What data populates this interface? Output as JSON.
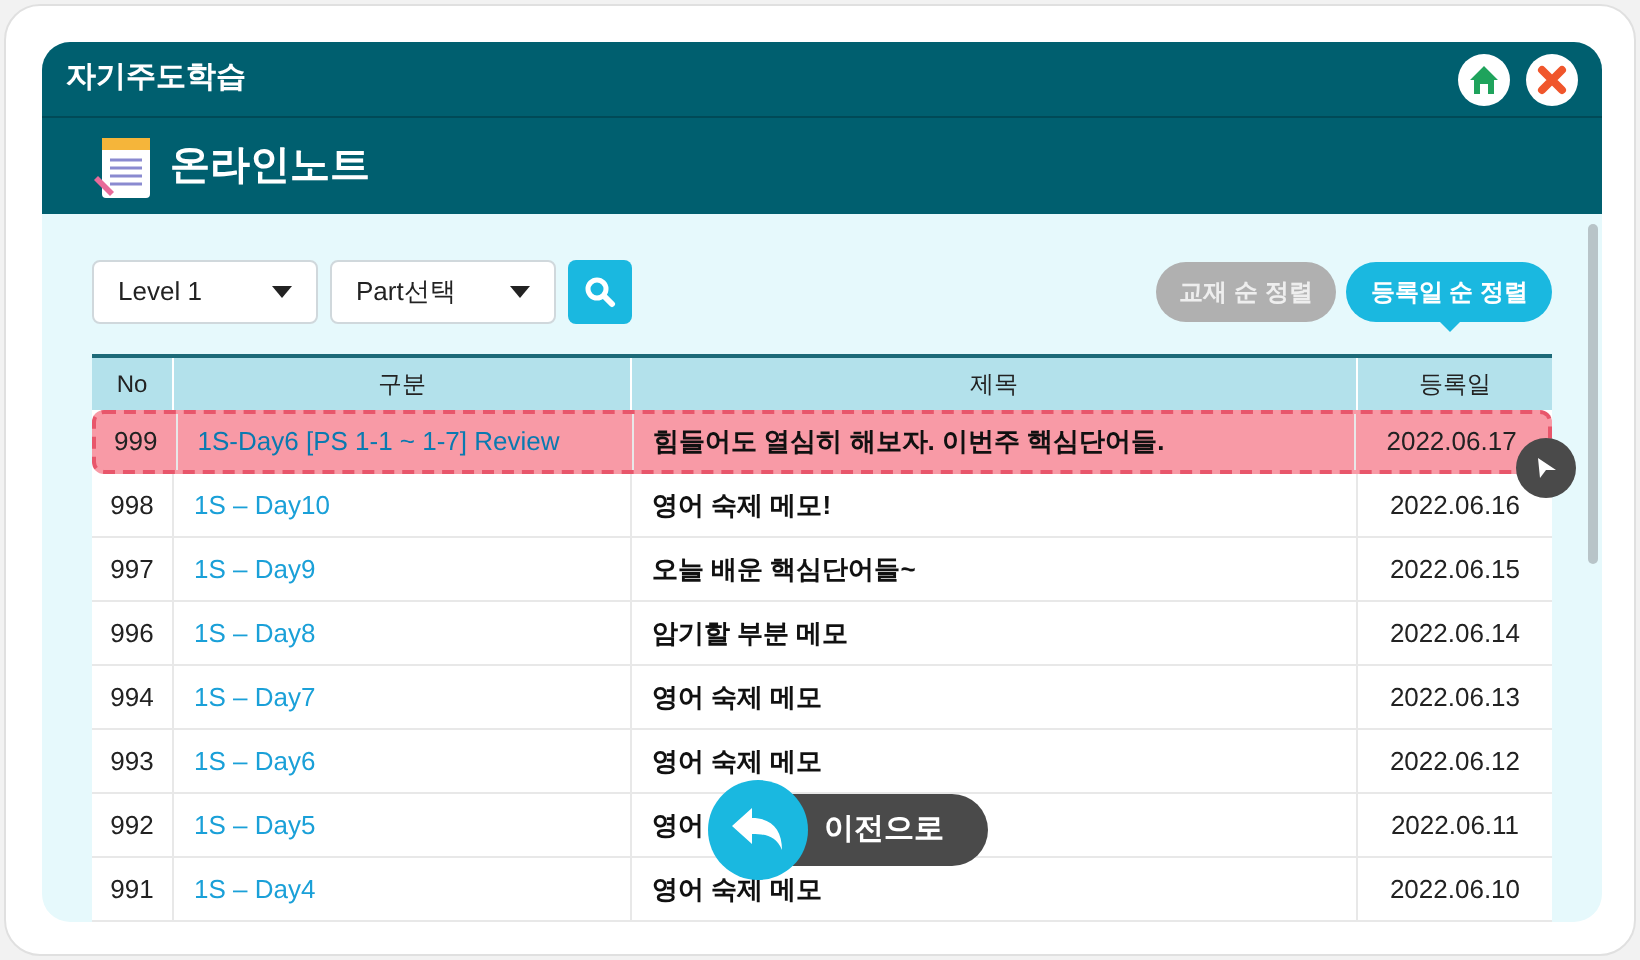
{
  "window": {
    "title": "자기주도학습"
  },
  "header": {
    "title": "온라인노트"
  },
  "filters": [
    {
      "value": "Level 1"
    },
    {
      "value": "Part선택"
    }
  ],
  "sort_buttons": [
    {
      "label": "교재 순 정렬",
      "selected": false
    },
    {
      "label": "등록일 순 정렬",
      "selected": true
    }
  ],
  "table": {
    "columns": [
      "No",
      "구분",
      "제목",
      "등록일"
    ],
    "rows": [
      {
        "no": "999",
        "category": "1S-Day6 [PS 1-1 ~ 1-7] Review",
        "title": "힘들어도 열심히 해보자. 이번주 핵심단어들.",
        "date": "2022.06.17",
        "selected": true
      },
      {
        "no": "998",
        "category": "1S – Day10",
        "title": "영어 숙제 메모!",
        "date": "2022.06.16",
        "selected": false
      },
      {
        "no": "997",
        "category": "1S – Day9",
        "title": "오늘 배운 핵심단어들~",
        "date": "2022.06.15",
        "selected": false
      },
      {
        "no": "996",
        "category": "1S – Day8",
        "title": "암기할 부분 메모",
        "date": "2022.06.14",
        "selected": false
      },
      {
        "no": "994",
        "category": "1S – Day7",
        "title": "영어 숙제 메모",
        "date": "2022.06.13",
        "selected": false
      },
      {
        "no": "993",
        "category": "1S – Day6",
        "title": "영어 숙제 메모",
        "date": "2022.06.12",
        "selected": false
      },
      {
        "no": "992",
        "category": "1S – Day5",
        "title": "영어",
        "date": "2022.06.11",
        "selected": false
      },
      {
        "no": "991",
        "category": "1S – Day4",
        "title": "영어 숙제 메모",
        "date": "2022.06.10",
        "selected": false
      }
    ]
  },
  "back_button": {
    "label": "이전으로"
  }
}
